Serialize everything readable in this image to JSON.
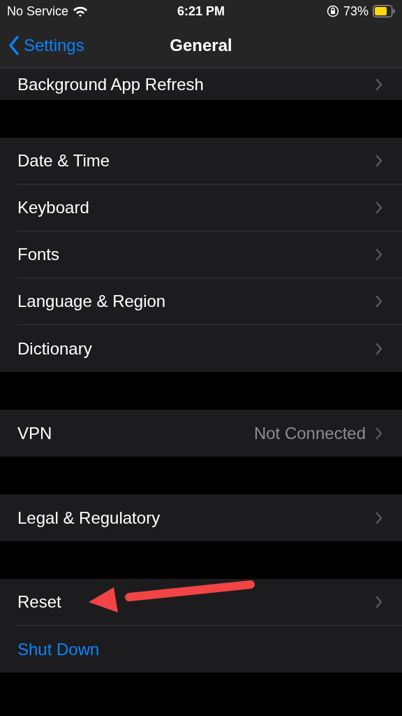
{
  "status_bar": {
    "carrier": "No Service",
    "time": "6:21 PM",
    "battery": "73%"
  },
  "nav": {
    "back": "Settings",
    "title": "General"
  },
  "groups": [
    {
      "rows": [
        {
          "kind": "link",
          "label": "Background App Refresh"
        }
      ]
    },
    {
      "rows": [
        {
          "kind": "link",
          "label": "Date & Time"
        },
        {
          "kind": "link",
          "label": "Keyboard"
        },
        {
          "kind": "link",
          "label": "Fonts"
        },
        {
          "kind": "link",
          "label": "Language & Region"
        },
        {
          "kind": "link",
          "label": "Dictionary"
        }
      ]
    },
    {
      "rows": [
        {
          "kind": "link",
          "label": "VPN",
          "value": "Not Connected"
        }
      ]
    },
    {
      "rows": [
        {
          "kind": "link",
          "label": "Legal & Regulatory"
        }
      ]
    },
    {
      "rows": [
        {
          "kind": "link",
          "label": "Reset"
        },
        {
          "kind": "action",
          "label": "Shut Down"
        }
      ]
    }
  ]
}
